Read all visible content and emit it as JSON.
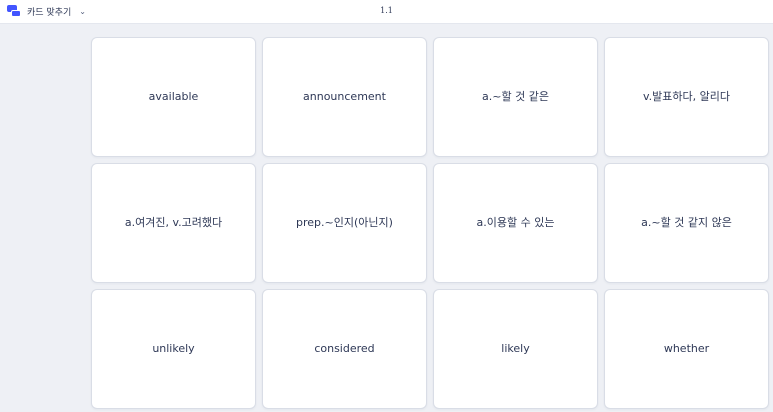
{
  "header": {
    "mode_label": "카드 맞추기",
    "mode_dropdown_icon": "chevron-down-icon",
    "progress": "1.1",
    "brand_color": "#4255ff"
  },
  "cards": [
    "available",
    "announcement",
    "a.~할 것 같은",
    "v.발표하다, 알리다",
    "a.여겨진, v.고려했다",
    "prep.~인지(아닌지)",
    "a.이용할 수 있는",
    "a.~할 것 같지 않은",
    "unlikely",
    "considered",
    "likely",
    "whether"
  ]
}
